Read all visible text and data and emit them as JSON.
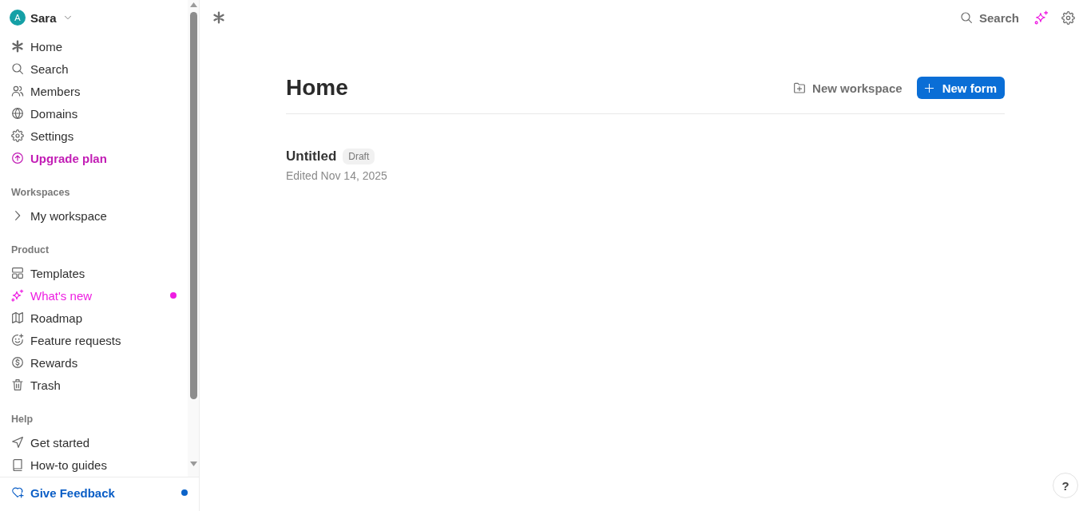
{
  "sidebar": {
    "account": {
      "avatar_initial": "A",
      "name": "Sara"
    },
    "nav": [
      {
        "label": "Home",
        "kind": "link"
      },
      {
        "label": "Search",
        "kind": "link"
      },
      {
        "label": "Members",
        "kind": "link"
      },
      {
        "label": "Domains",
        "kind": "link"
      },
      {
        "label": "Settings",
        "kind": "link"
      },
      {
        "label": "Upgrade plan",
        "kind": "upgrade"
      }
    ],
    "workspaces": {
      "title": "Workspaces",
      "items": [
        {
          "label": "My workspace",
          "expanded": false
        }
      ]
    },
    "product": {
      "title": "Product",
      "items": [
        {
          "label": "Templates",
          "kind": "link",
          "unread": false
        },
        {
          "label": "What's new",
          "kind": "highlight",
          "unread": true
        },
        {
          "label": "Roadmap",
          "kind": "link",
          "unread": false
        },
        {
          "label": "Feature requests",
          "kind": "link",
          "unread": false
        },
        {
          "label": "Rewards",
          "kind": "link",
          "unread": false
        },
        {
          "label": "Trash",
          "kind": "link",
          "unread": false
        }
      ]
    },
    "help": {
      "title": "Help",
      "items": [
        {
          "label": "Get started"
        },
        {
          "label": "How-to guides"
        }
      ]
    },
    "feedback": {
      "label": "Give Feedback",
      "unread": true
    }
  },
  "topbar": {
    "search": "Search"
  },
  "main": {
    "title": "Home",
    "actions": [
      {
        "label": "New workspace",
        "kind": "secondary"
      },
      {
        "label": "New form",
        "kind": "primary"
      }
    ],
    "forms": [
      {
        "title": "Untitled",
        "status": "Draft",
        "edited": "Edited Nov 14, 2025"
      }
    ]
  },
  "help_button": "?"
}
